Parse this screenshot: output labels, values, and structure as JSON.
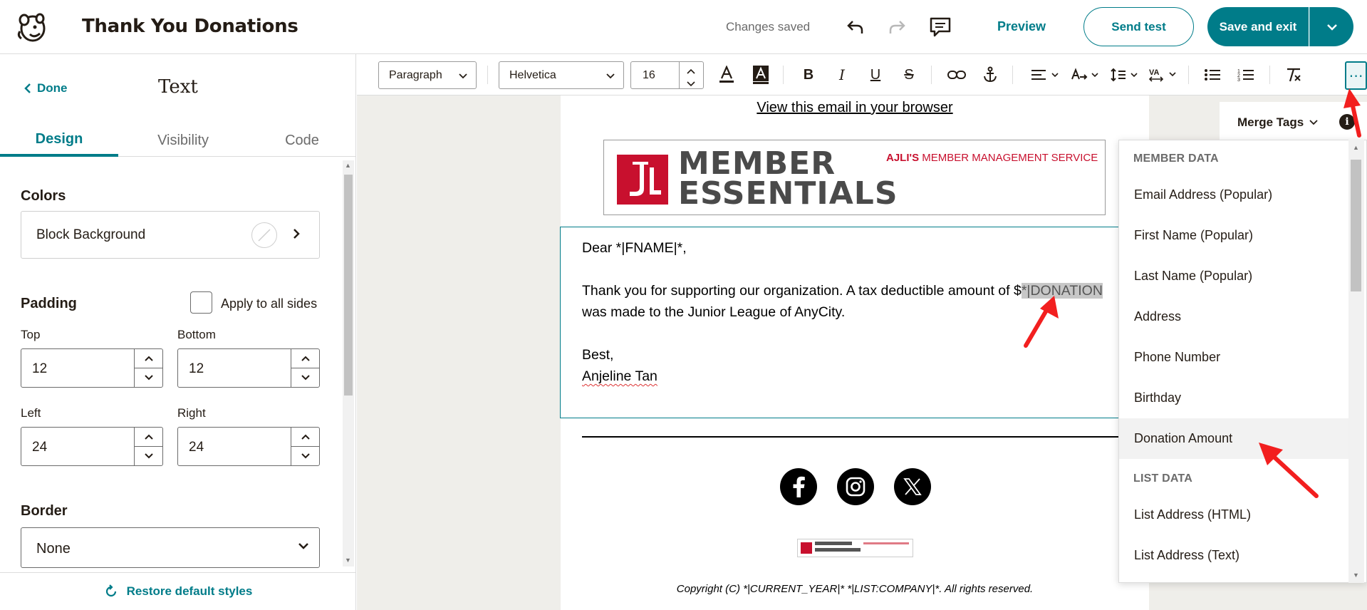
{
  "header": {
    "title": "Thank You Donations",
    "status": "Changes saved",
    "preview": "Preview",
    "send_test": "Send test",
    "save_exit": "Save and exit"
  },
  "panel": {
    "done": "Done",
    "title": "Text",
    "tabs": [
      "Design",
      "Visibility",
      "Code"
    ],
    "colors_label": "Colors",
    "block_background": "Block Background",
    "padding_label": "Padding",
    "apply_all": "Apply to all sides",
    "top_label": "Top",
    "top_value": "12",
    "bottom_label": "Bottom",
    "bottom_value": "12",
    "left_label": "Left",
    "left_value": "24",
    "right_label": "Right",
    "right_value": "24",
    "border_label": "Border",
    "border_value": "None",
    "restore": "Restore default styles"
  },
  "toolbar": {
    "paragraph": "Paragraph",
    "font": "Helvetica",
    "size": "16"
  },
  "email": {
    "view_browser": "View this email in your browser",
    "banner_title_1": "MEMBER",
    "banner_title_2": "ESSENTIALS",
    "banner_tag_bold": "AJLI'S",
    "banner_tag": "MEMBER MANAGEMENT SERVICE",
    "greeting": "Dear *|FNAME|*,",
    "body_1": "Thank you for supporting our organization. A tax deductible amount of $",
    "merge_tag": "*|DONATION",
    "body_2": "was made to the Junior League of AnyCity.",
    "closing": "Best,",
    "signature": "Anjeline Tan",
    "copyright": "Copyright (C) *|CURRENT_YEAR|* *|LIST:COMPANY|*. All rights reserved."
  },
  "merge_tags": {
    "label": "Merge Tags",
    "groups": [
      {
        "name": "MEMBER DATA",
        "items": [
          "Email Address (Popular)",
          "First Name (Popular)",
          "Last Name (Popular)",
          "Address",
          "Phone Number",
          "Birthday",
          "Donation Amount"
        ]
      },
      {
        "name": "LIST DATA",
        "items": [
          "List Address (HTML)",
          "List Address (Text)"
        ]
      }
    ]
  },
  "colors": {
    "accent": "#007c89",
    "annotation_arrow": "#f21f1f",
    "brand_red": "#c8102e"
  }
}
